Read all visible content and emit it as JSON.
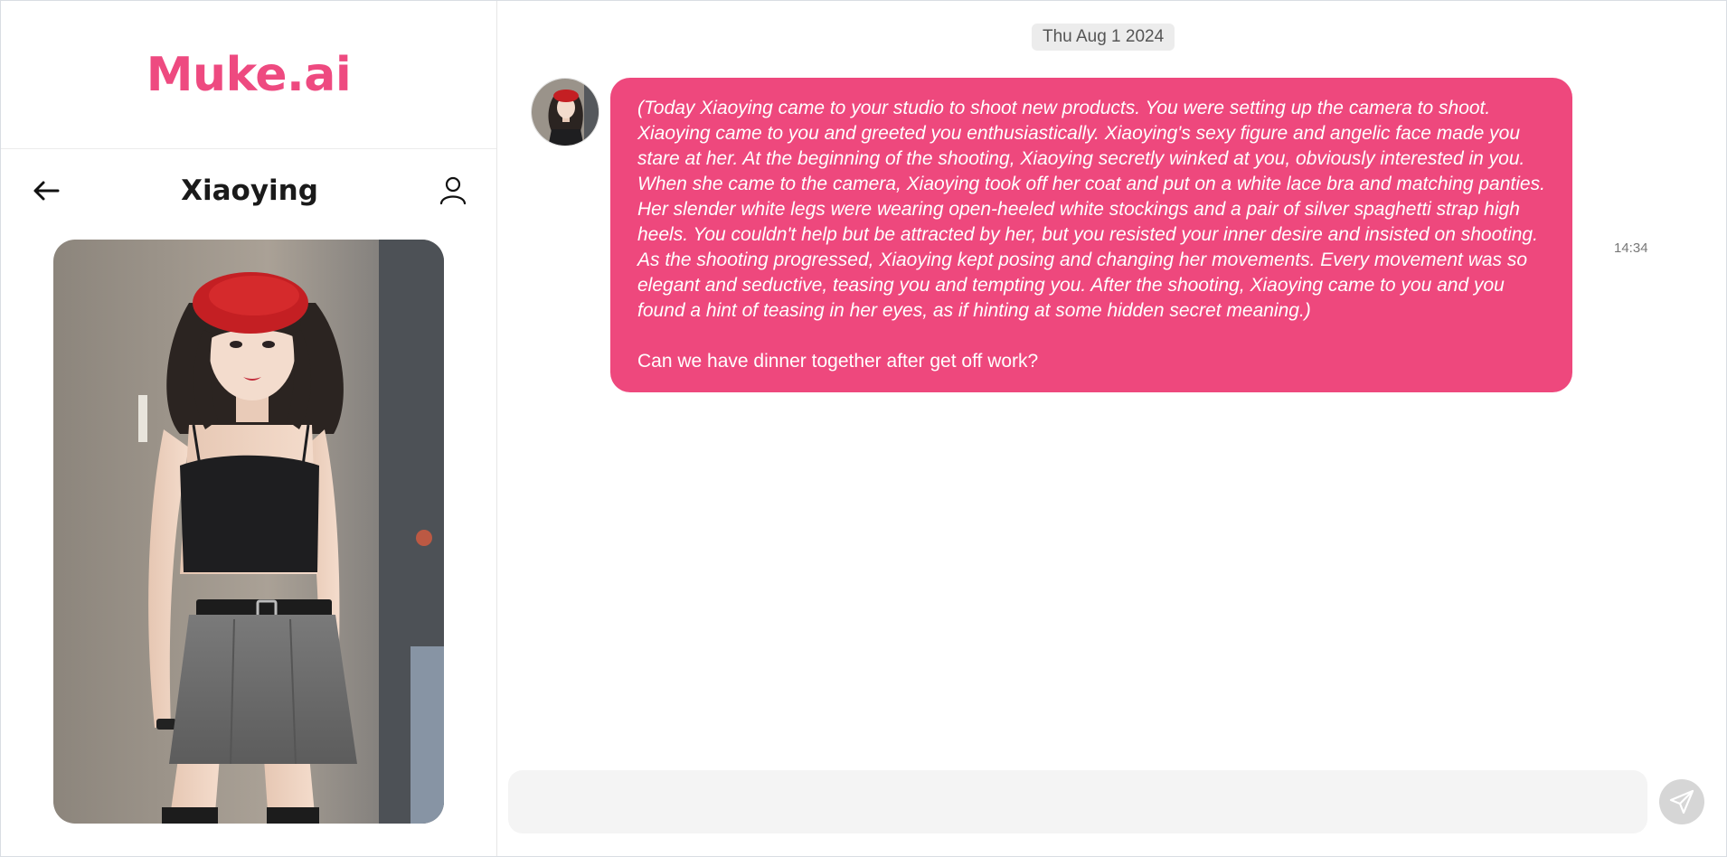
{
  "app": {
    "brand": "Muke.ai",
    "accent_color": "#ee4a80"
  },
  "sidebar": {
    "back_icon": "arrow-left-icon",
    "character_name": "Xiaoying",
    "profile_icon": "user-icon",
    "portrait_alt": "Xiaoying portrait"
  },
  "chat": {
    "date_label": "Thu Aug 1 2024",
    "messages": [
      {
        "sender": "Xiaoying",
        "narration": "(Today Xiaoying came to your studio to shoot new products. You were setting up the camera to shoot. Xiaoying came to you and greeted you enthusiastically. Xiaoying's sexy figure and angelic face made you stare at her. At the beginning of the shooting, Xiaoying secretly winked at you, obviously interested in you. When she came to the camera, Xiaoying took off her coat and put on a white lace bra and matching panties. Her slender white legs were wearing open-heeled white stockings and a pair of silver spaghetti strap high heels. You couldn't help but be attracted by her, but you resisted your inner desire and insisted on shooting. As the shooting progressed, Xiaoying kept posing and changing her movements. Every movement was so elegant and seductive, teasing you and tempting you. After the shooting, Xiaoying came to you and you found a hint of teasing in her eyes, as if hinting at some hidden secret meaning.)",
        "speech": "Can we have dinner together after get off work?",
        "time": "14:34",
        "bubble_color": "#ee487d"
      }
    ],
    "composer": {
      "value": "",
      "placeholder": ""
    },
    "send_icon": "send-icon"
  }
}
